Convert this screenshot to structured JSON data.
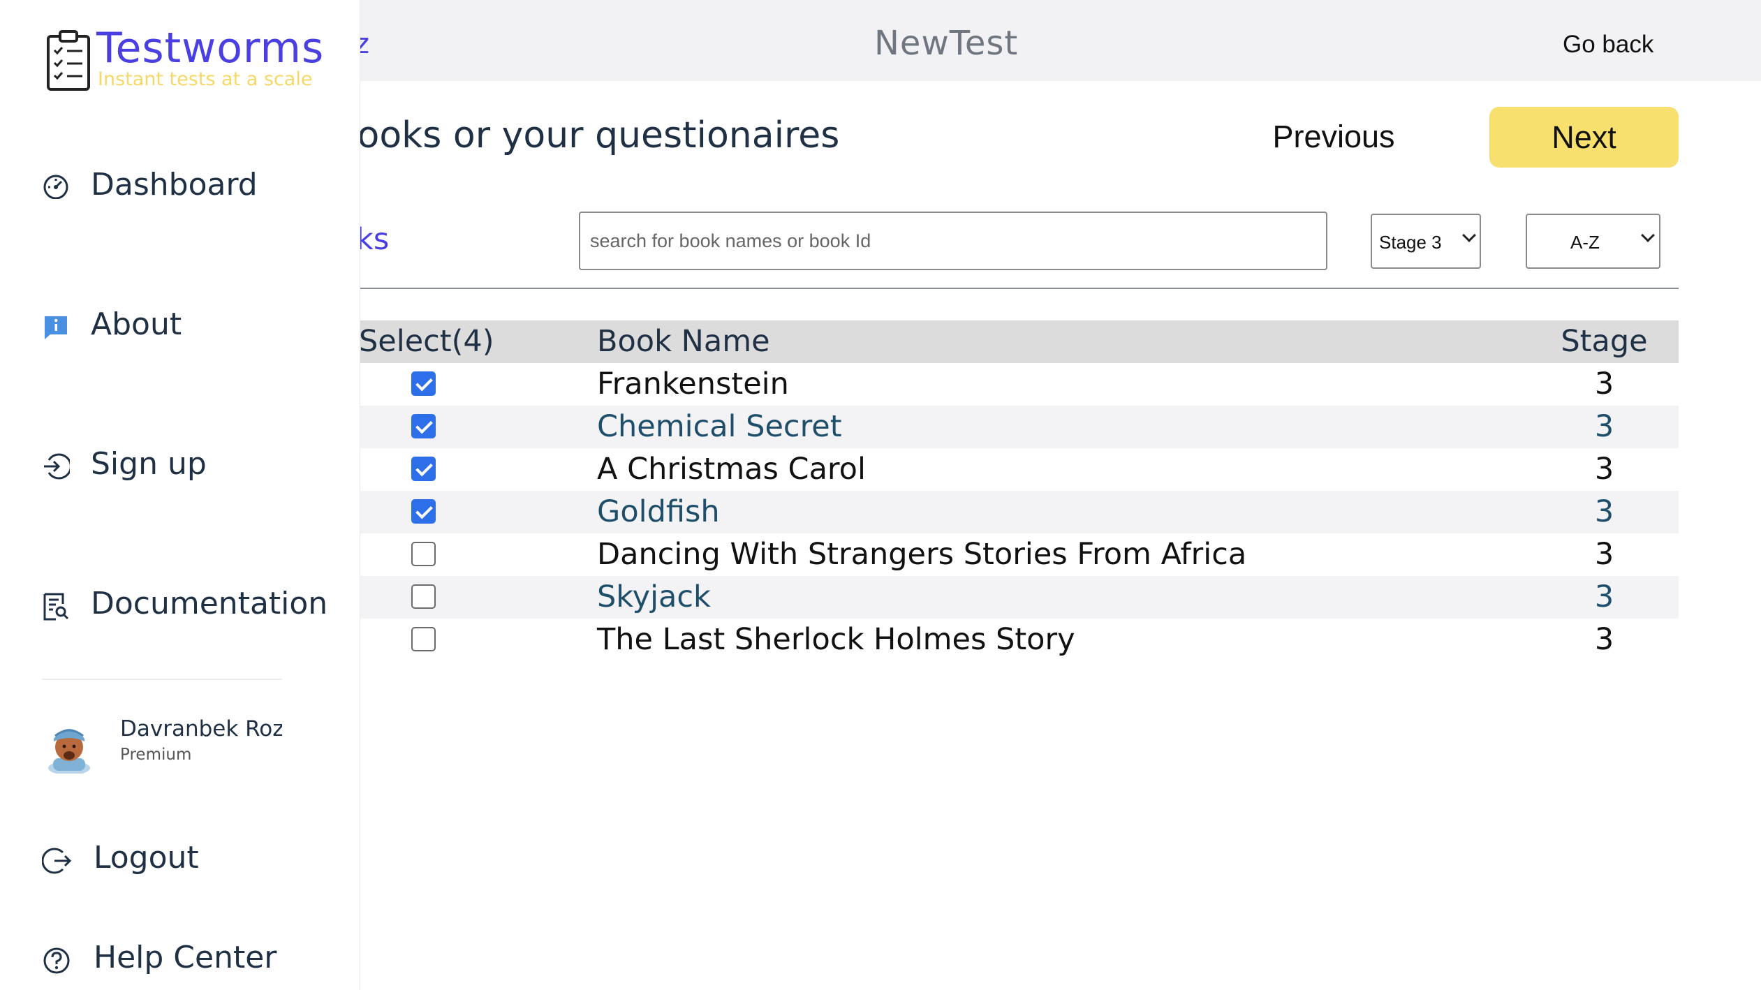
{
  "topbar": {
    "left_glyph": "z",
    "title": "NewTest",
    "go_back_label": "Go back"
  },
  "main": {
    "heading": "e books or your questionaires",
    "previous_label": "Previous",
    "next_label": "Next",
    "section_label": "books",
    "search": {
      "placeholder": "search for book names or book Id",
      "value": ""
    },
    "stage_filter": "Stage 3",
    "sort_order": "A-Z"
  },
  "table": {
    "headers": {
      "select": "Select(4)",
      "name": "Book Name",
      "stage": "Stage"
    },
    "rows": [
      {
        "checked": true,
        "name": "Frankenstein",
        "stage": "3"
      },
      {
        "checked": true,
        "name": "Chemical Secret",
        "stage": "3"
      },
      {
        "checked": true,
        "name": "A Christmas Carol",
        "stage": "3"
      },
      {
        "checked": true,
        "name": "Goldfish",
        "stage": "3"
      },
      {
        "checked": false,
        "name": "Dancing With Strangers Stories From Africa",
        "stage": "3"
      },
      {
        "checked": false,
        "name": "Skyjack",
        "stage": "3"
      },
      {
        "checked": false,
        "name": "The Last Sherlock Holmes Story",
        "stage": "3"
      }
    ]
  },
  "sidebar": {
    "brand": "Testworms",
    "tagline": "Instant tests at a scale",
    "items": [
      {
        "label": "Dashboard",
        "icon": "dashboard-gauge-icon"
      },
      {
        "label": "About",
        "icon": "info-icon"
      },
      {
        "label": "Sign up",
        "icon": "sign-in-icon"
      },
      {
        "label": "Documentation",
        "icon": "document-search-icon"
      },
      {
        "label": "Logout",
        "icon": "logout-icon"
      },
      {
        "label": "Help Center",
        "icon": "help-icon"
      }
    ],
    "user": {
      "name": "Davranbek Rozn",
      "plan": "Premium"
    }
  },
  "colors": {
    "brand": "#4a3fe0",
    "accent_yellow": "#f8e06f",
    "checkbox_blue": "#2d6fe8",
    "text_dark": "#1f3044"
  }
}
